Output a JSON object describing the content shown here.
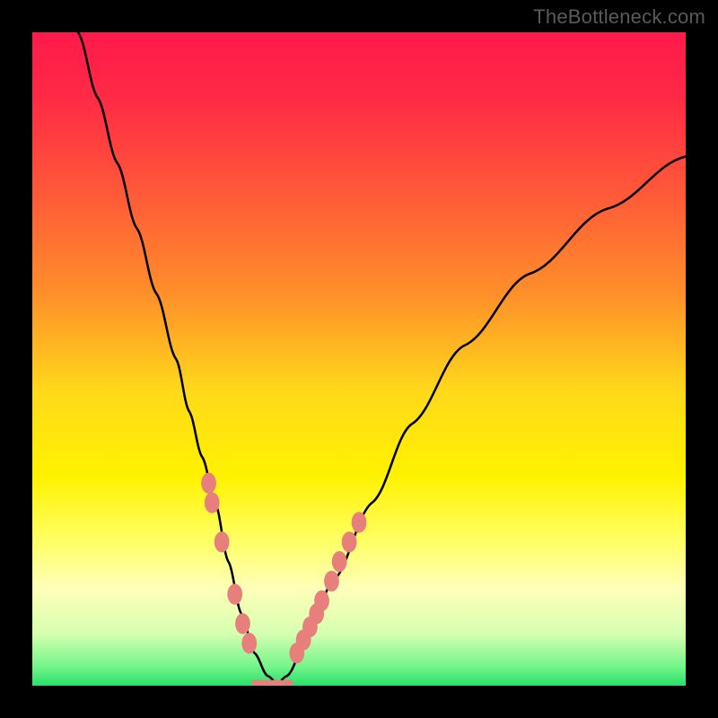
{
  "attribution": "TheBottleneck.com",
  "colors": {
    "frame": "#000000",
    "gradient_stops": [
      {
        "offset": 0.0,
        "color": "#ff1a4b"
      },
      {
        "offset": 0.1,
        "color": "#ff2a45"
      },
      {
        "offset": 0.25,
        "color": "#ff5a38"
      },
      {
        "offset": 0.4,
        "color": "#ff8f2a"
      },
      {
        "offset": 0.55,
        "color": "#ffd91a"
      },
      {
        "offset": 0.68,
        "color": "#fff200"
      },
      {
        "offset": 0.78,
        "color": "#ffff66"
      },
      {
        "offset": 0.85,
        "color": "#ffffb8"
      },
      {
        "offset": 0.92,
        "color": "#d6ffb0"
      },
      {
        "offset": 0.97,
        "color": "#75f58a"
      },
      {
        "offset": 1.0,
        "color": "#29e06a"
      }
    ],
    "curve": "#000000",
    "markers": "#e77f7c"
  },
  "chart_data": {
    "type": "line",
    "title": "",
    "xlabel": "",
    "ylabel": "",
    "xlim": [
      0,
      100
    ],
    "ylim": [
      0,
      100
    ],
    "grid": false,
    "legend": false,
    "series": [
      {
        "name": "curve",
        "x": [
          7,
          10,
          13,
          16,
          19,
          22,
          24,
          26,
          28,
          30,
          32,
          34,
          36,
          37.5,
          39,
          42,
          46,
          52,
          58,
          66,
          76,
          88,
          100
        ],
        "y": [
          100,
          90,
          80,
          70,
          60,
          50,
          42,
          35,
          28,
          19,
          11,
          5,
          1.5,
          0.4,
          1.5,
          7,
          16,
          28,
          40,
          52,
          63,
          73,
          81
        ]
      },
      {
        "name": "markers-left",
        "x": [
          27.0,
          27.5,
          29.0,
          31.0,
          32.2,
          33.2
        ],
        "y": [
          31,
          28,
          22,
          14,
          9.5,
          6.5
        ]
      },
      {
        "name": "markers-right",
        "x": [
          40.5,
          41.5,
          42.5,
          43.5,
          44.3,
          45.8,
          47.0,
          48.5,
          50.0
        ],
        "y": [
          5,
          7,
          9,
          11,
          13,
          16,
          19,
          22,
          25
        ]
      },
      {
        "name": "markers-bottom",
        "x": [
          34.5,
          36.0,
          37.5,
          39.0
        ],
        "y": [
          0.45,
          0.45,
          0.45,
          0.45
        ]
      }
    ]
  }
}
